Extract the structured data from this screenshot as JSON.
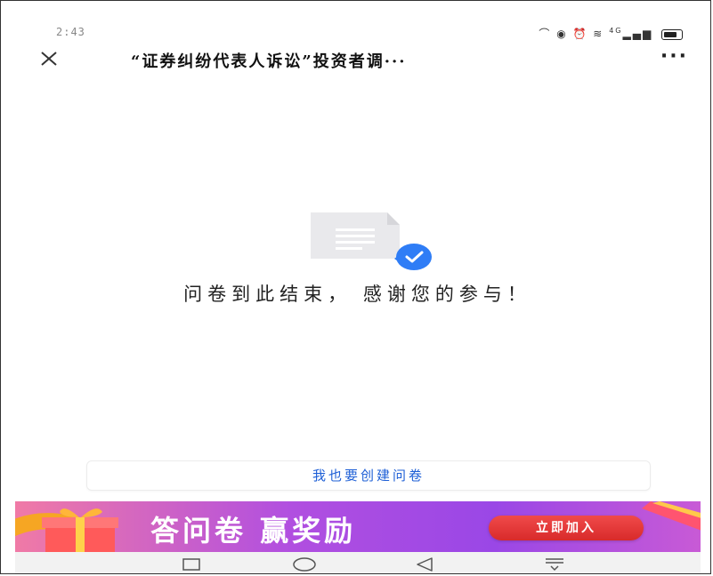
{
  "status_bar": {
    "time": "2:43",
    "network_label": "4G"
  },
  "header": {
    "title": "“证券纠纷代表人诉讼”投资者调···",
    "more": "···"
  },
  "main": {
    "end_message": "问卷到此结束， 感谢您的参与！",
    "create_button": "我也要创建问卷"
  },
  "promo": {
    "text": "答问卷  赢奖励",
    "join_button": "立即加入"
  },
  "colors": {
    "link_blue": "#1e5fd6",
    "check_blue": "#2f7df6",
    "promo_purple": "#9a47e6",
    "join_red": "#e03535"
  },
  "icons": [
    "close-icon",
    "more-icon",
    "document-icon",
    "check-badge-icon",
    "gift-icon",
    "recent-apps-icon",
    "home-icon",
    "back-icon",
    "keyboard-hide-icon"
  ]
}
